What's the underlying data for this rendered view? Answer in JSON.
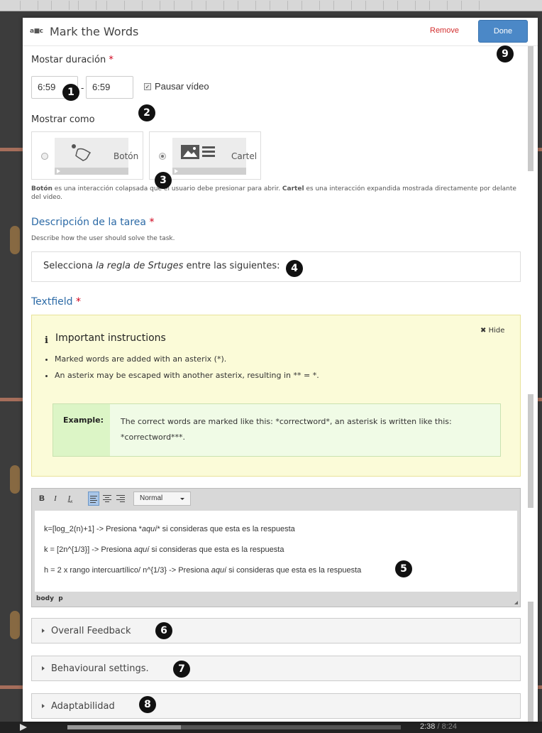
{
  "dialog": {
    "logo": "a■c",
    "title": "Mark the Words",
    "remove_label": "Remove",
    "done_label": "Done"
  },
  "duration": {
    "label": "Mostar duración",
    "required": "*",
    "from_value": "6:59",
    "separator": "-",
    "to_value": "6:59",
    "pause_label": "Pausar vídeo",
    "pause_checked": true
  },
  "display": {
    "label": "Mostrar como",
    "options": [
      {
        "label": "Botón",
        "selected": false
      },
      {
        "label": "Cartel",
        "selected": true
      }
    ],
    "help_bold_1": "Botón",
    "help_text_1": " es una interacción colapsada que el usuario debe presionar para abrir. ",
    "help_bold_2": "Cartel",
    "help_text_2": " es una interacción expandida mostrada directamente por delante del video."
  },
  "task": {
    "label": "Descripción de la tarea",
    "required": "*",
    "help": "Describe how the user should solve the task.",
    "value_prefix": "Selecciona ",
    "value_emph": "la regla de Srtuges",
    "value_suffix": " entre las siguientes:"
  },
  "textfield": {
    "label": "Textfield",
    "required": "*"
  },
  "instructions": {
    "icon": "i",
    "title": "Important instructions",
    "hide_label": "Hide",
    "bullets": [
      "Marked words are added with an asterix (*).",
      "An asterix may be escaped with another asterix, resulting in ** = *."
    ],
    "example_label": "Example:",
    "example_text": "The correct words are marked like this: *correctword*, an asterisk is written like this: *correctword***."
  },
  "editor": {
    "format_value": "Normal",
    "lines": [
      {
        "pre": "k=[log_2(n)+1] -> Presiona *",
        "em": "aquí",
        "post": "* si consideras que esta es la respuesta"
      },
      {
        "pre": "k = [2n^{1/3}] -> Presiona ",
        "em": "aquí",
        "post": " si consideras que esta es la respuesta"
      },
      {
        "pre": "h = 2 x rango intercuartílico/ n^{1/3} -> Presiona ",
        "em": "aquí",
        "post": " si consideras que esta es la respuesta"
      }
    ],
    "path_body": "body",
    "path_p": "p"
  },
  "sections": [
    {
      "label": "Overall Feedback"
    },
    {
      "label": "Behavioural settings."
    },
    {
      "label": "Adaptabilidad"
    }
  ],
  "badges": [
    "1",
    "2",
    "3",
    "4",
    "5",
    "6",
    "7",
    "8",
    "9"
  ],
  "player": {
    "current_time": "2:38",
    "total_time": "/ 8:24"
  },
  "colors": {
    "accent_button": "#4b88c7",
    "remove_link": "#d32f2f",
    "required": "#d0021b",
    "heading_blue": "#2c6aa6",
    "instructions_bg": "#fbfbd8",
    "example_bg": "#f0fbe6"
  }
}
